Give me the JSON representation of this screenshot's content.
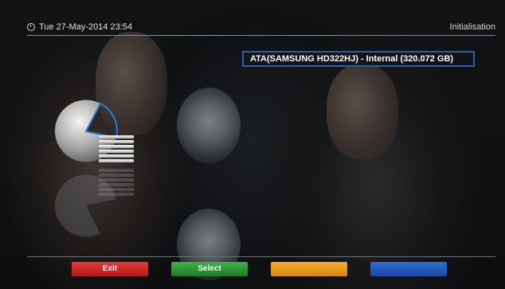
{
  "header": {
    "datetime": "Tue 27-May-2014 23:54",
    "title": "Initialisation"
  },
  "device": {
    "label": "ATA(SAMSUNG HD322HJ) - Internal (320.072 GB)"
  },
  "footer": {
    "buttons": [
      {
        "label": "Exit",
        "color": "#c62828"
      },
      {
        "label": "Select",
        "color": "#2e8b3a"
      },
      {
        "label": "",
        "color": "#e8961c"
      },
      {
        "label": "",
        "color": "#2458bd"
      }
    ]
  },
  "colors": {
    "accent_border": "#2d5fa8",
    "header_line": "#8a8f93"
  }
}
